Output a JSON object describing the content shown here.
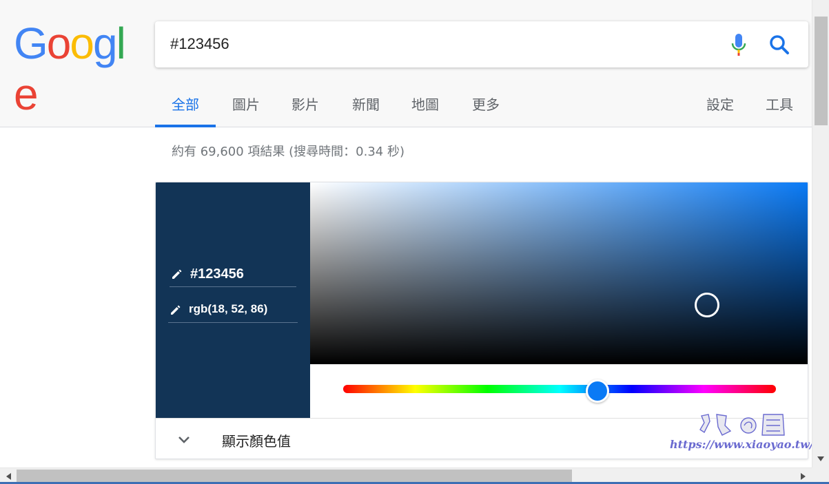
{
  "logo": {
    "letters": [
      "G",
      "o",
      "o",
      "g",
      "l",
      "e"
    ],
    "colors": {
      "blue": "#4285F4",
      "red": "#EA4335",
      "yellow": "#FBBC05",
      "green": "#34A853"
    }
  },
  "search": {
    "query": "#123456"
  },
  "icons": {
    "mic": "mic-icon",
    "search": "search-icon",
    "pencil": "pencil-icon",
    "chevron": "chevron-down-icon"
  },
  "tabs": [
    {
      "label": "全部",
      "active": true
    },
    {
      "label": "圖片"
    },
    {
      "label": "影片"
    },
    {
      "label": "新聞"
    },
    {
      "label": "地圖"
    },
    {
      "label": "更多"
    }
  ],
  "tools": {
    "settings": "設定",
    "tools": "工具"
  },
  "result_stats": "約有 69,600 項結果 (搜尋時間：0.34 秒)",
  "color_picker": {
    "hex": "#123456",
    "rgb": "rgb(18, 52, 86)",
    "swatch_color": "#123456",
    "hue_color": "#0a7af5",
    "show_values_label": "顯示顏色值"
  },
  "watermark": {
    "url": "https://www.xiaoyao.tw/"
  },
  "colors": {
    "accent": "#1a73e8",
    "tab_text": "#5f6368",
    "stats_text": "#70757a"
  }
}
